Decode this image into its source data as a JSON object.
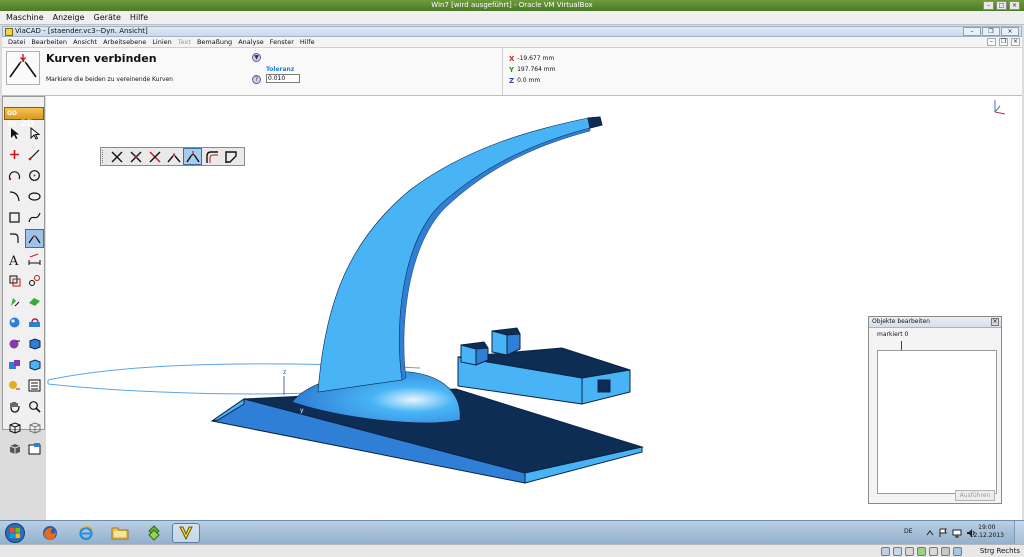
{
  "vbox": {
    "title": "Win7 [wird ausgeführt] - Oracle VM VirtualBox",
    "menu": [
      "Maschine",
      "Anzeige",
      "Geräte",
      "Hilfe"
    ],
    "host_key": "Strg Rechts"
  },
  "app": {
    "title": "ViaCAD - [staender.vc3--Dyn. Ansicht]",
    "menu": [
      "Datei",
      "Bearbeiten",
      "Ansicht",
      "Arbeitsebene",
      "Linien",
      "Text",
      "Bemaßung",
      "Analyse",
      "Fenster",
      "Hilfe"
    ]
  },
  "tool": {
    "title": "Kurven verbinden",
    "hint": "Markiere die beiden zu vereinende Kurven",
    "tolerance_label": "Toleranz",
    "tolerance_value": "0.010",
    "help_glyph": "?",
    "options_glyph": "▼"
  },
  "coords": {
    "x_label": "X",
    "x_value": "-19.677 mm",
    "y_label": "Y",
    "y_value": "197.764 mm",
    "z_label": "Z",
    "z_value": "0.0 mm",
    "colors": {
      "x": "#d62020",
      "y": "#1f9a1f",
      "z": "#2a3fd0"
    }
  },
  "palette": {
    "go_to": "GO TO",
    "go_2d": "2D",
    "tools": [
      "select-arrow-icon",
      "select-subobject-icon",
      "point-icon",
      "line-icon",
      "arc-icon",
      "circle-icon",
      "curve-icon",
      "ellipse-icon",
      "rectangle-icon",
      "spline-icon",
      "fillet-curve-icon",
      "join-curves-icon",
      "text-icon",
      "dimension-icon",
      "transform-icon",
      "copy-icon",
      "solid-extrude-icon",
      "surface-icon",
      "sphere-icon",
      "boolean-icon",
      "shell-icon",
      "block-icon",
      "solid-edit-icon",
      "solid-modify-icon",
      "render-icon",
      "layers-icon",
      "pan-hand-icon",
      "zoom-icon",
      "view-iso-icon",
      "view-front-icon",
      "view-shaded-icon",
      "view-settings-icon"
    ],
    "active_tool": "join-curves-icon"
  },
  "fillet_toolbar": {
    "buttons": [
      "trim-cross-icon",
      "break-cross-icon",
      "trim-single-icon",
      "extend-corner-icon",
      "join-curves-icon",
      "fillet-icon",
      "chamfer-icon"
    ],
    "active": "join-curves-icon"
  },
  "viewport": {
    "axis_labels": {
      "x": "x",
      "y": "y",
      "z": "z"
    },
    "model_colors": {
      "top": "#49b4f5",
      "side": "#2f7fd6",
      "dark": "#0d2d55",
      "edge": "#0a2345",
      "dome_light": "#e8f6ff"
    }
  },
  "objects_panel": {
    "title": "Objekte bearbeiten",
    "marked_label": "markiert 0",
    "run_button": "Ausführen"
  },
  "taskbar": {
    "apps": [
      "firefox-icon",
      "internet-explorer-icon",
      "explorer-folder-icon",
      "app-green-icon",
      "viacad-icon"
    ],
    "active_app": "viacad-icon",
    "language": "DE",
    "time": "19:00",
    "date": "12.12.2013"
  }
}
